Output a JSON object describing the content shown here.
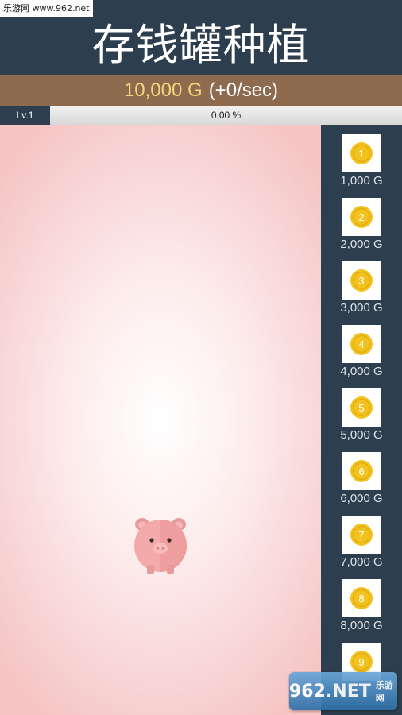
{
  "watermark_top": "乐游网 www.962.net",
  "header": {
    "title": "存钱罐种植"
  },
  "money_bar": {
    "amount": "10,000 G",
    "rate": "(+0/sec)"
  },
  "level": {
    "label": "Lv.1",
    "progress_text": "0.00 %",
    "progress_fraction": 0.0
  },
  "shop": {
    "items": [
      {
        "number": "1",
        "price": "1,000 G"
      },
      {
        "number": "2",
        "price": "2,000 G"
      },
      {
        "number": "3",
        "price": "3,000 G"
      },
      {
        "number": "4",
        "price": "4,000 G"
      },
      {
        "number": "5",
        "price": "5,000 G"
      },
      {
        "number": "6",
        "price": "6,000 G"
      },
      {
        "number": "7",
        "price": "7,000 G"
      },
      {
        "number": "8",
        "price": "8,000 G"
      },
      {
        "number": "9",
        "price": ""
      }
    ]
  },
  "watermark_bottom": {
    "main": "962.NET",
    "sub": "乐游网"
  },
  "colors": {
    "header_bg": "#2d3e4e",
    "money_bar_bg": "#8e6b4f",
    "coin": "#f2c21f",
    "pig": "#f2a6a6"
  },
  "icons": {
    "coin": "gold-coin-icon",
    "pig": "piggy-bank-icon"
  }
}
